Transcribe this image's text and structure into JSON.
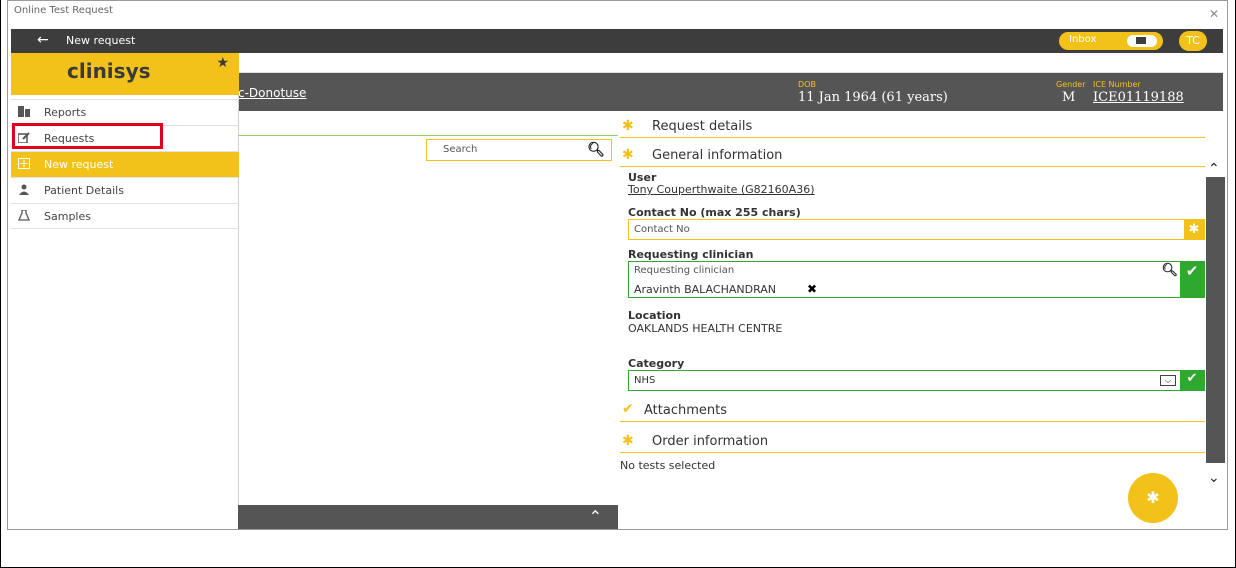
{
  "window": {
    "title": "Online Test Request",
    "close": "✕"
  },
  "topbar": {
    "back_label": "New request",
    "inbox_label": "Inbox",
    "avatar_initials": "TC"
  },
  "brand": {
    "logo": "clinisys"
  },
  "sidebar": {
    "items": [
      {
        "label": "Reports",
        "icon": "reports-icon"
      },
      {
        "label": "Requests",
        "icon": "edit-icon"
      },
      {
        "label": "New request",
        "icon": "plus-box-icon"
      },
      {
        "label": "Patient Details",
        "icon": "person-icon"
      },
      {
        "label": "Samples",
        "icon": "flask-icon"
      }
    ]
  },
  "patient": {
    "name_fragment": "c-Donotuse",
    "dob_caption": "DOB",
    "dob_value": "11 Jan 1964 (61 years)",
    "gender_caption": "Gender",
    "gender_value": "M",
    "ice_caption": "ICE Number",
    "ice_value": "ICE01119188"
  },
  "search": {
    "placeholder": "Search"
  },
  "sections": {
    "request_details": "Request details",
    "general_information": "General information",
    "attachments": "Attachments",
    "order_information": "Order information"
  },
  "form": {
    "user_label": "User",
    "user_value": "Tony Couperthwaite (G82160A36)",
    "contact_label": "Contact No (max 255 chars)",
    "contact_placeholder": "Contact No",
    "clinician_label": "Requesting clinician",
    "clinician_placeholder": "Requesting clinician",
    "clinician_value": "Aravinth BALACHANDRAN",
    "location_label": "Location",
    "location_value": "OAKLANDS HEALTH CENTRE",
    "category_label": "Category",
    "category_value": "NHS"
  },
  "order": {
    "empty_text": "No tests selected"
  },
  "colors": {
    "brand_yellow": "#f2c21b",
    "dark": "#3d3d3d",
    "ok_green": "#2ea82e",
    "highlight_red": "#e3001b"
  }
}
